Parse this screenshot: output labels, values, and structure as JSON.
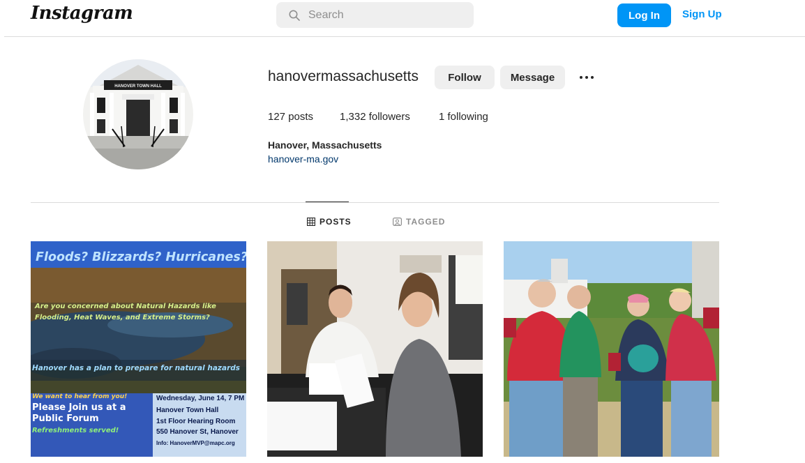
{
  "header": {
    "logo": "Instagram",
    "search_placeholder": "Search",
    "login_label": "Log In",
    "signup_label": "Sign Up",
    "accent_color": "#0095f6"
  },
  "profile": {
    "username": "hanovermassachusetts",
    "follow_label": "Follow",
    "message_label": "Message",
    "posts": "127 posts",
    "followers": "1,332 followers",
    "following": "1 following",
    "full_name": "Hanover, Massachusetts",
    "website": "hanover-ma.gov",
    "avatar_sign": "HANOVER TOWN HALL"
  },
  "tabs": {
    "posts_label": "POSTS",
    "tagged_label": "TAGGED"
  },
  "posts": {
    "flyer": {
      "headline": "Floods? Blizzards? Hurricanes?",
      "question_line1": "Are you concerned about Natural Hazards like",
      "question_line2": "Flooding, Heat Waves, and Extreme Storms?",
      "plan": "Hanover has a plan to prepare for natural hazards",
      "want": "We want to hear from you!",
      "join_line1": "Please Join us at a",
      "join_line2": "Public Forum",
      "refreshments": "Refreshments served!",
      "date": "Wednesday, June 14, 7 PM",
      "venue": "Hanover Town Hall",
      "room": "1st Floor Hearing Room",
      "address": "550 Hanover St, Hanover",
      "info": "Info: HanoverMVP@mapc.org"
    }
  }
}
